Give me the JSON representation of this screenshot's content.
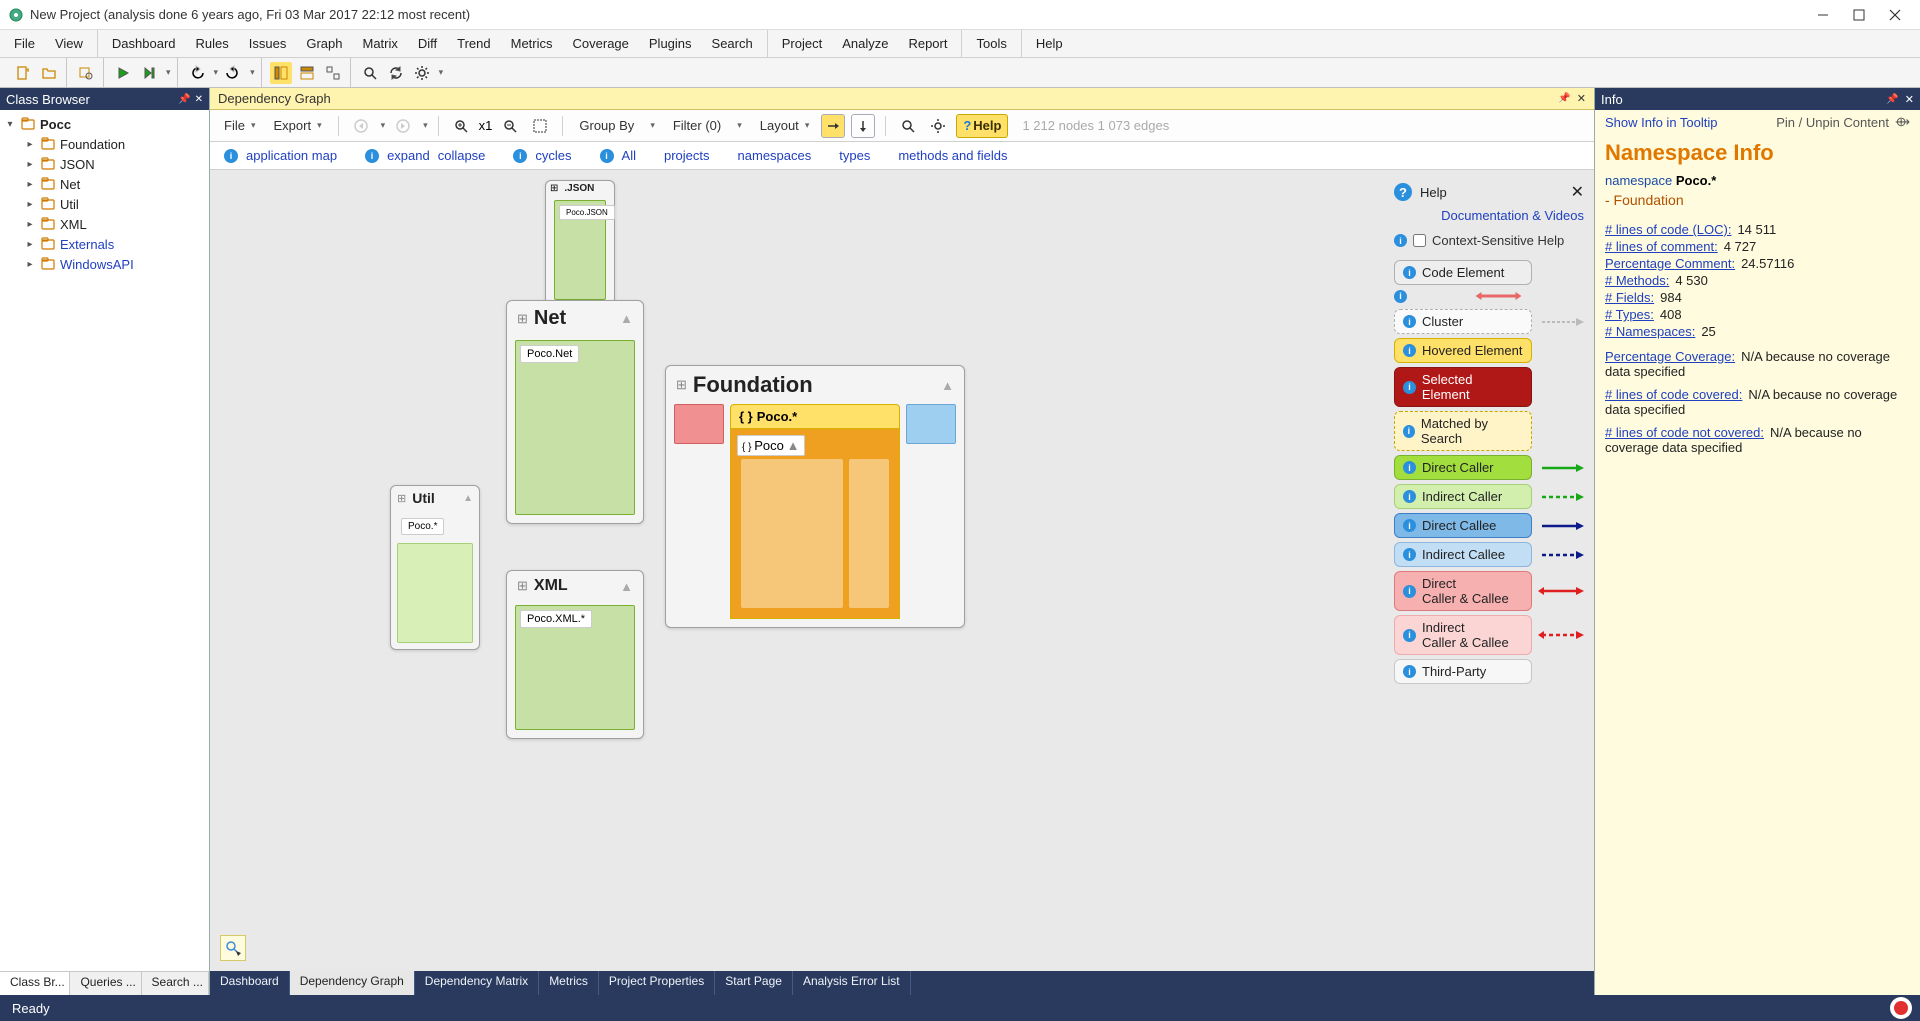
{
  "titlebar": {
    "text": "New Project  (analysis done 6 years ago, Fri 03 Mar 2017  22:12 most recent)"
  },
  "menubar": {
    "group1": [
      "File",
      "View"
    ],
    "group2": [
      "Dashboard",
      "Rules",
      "Issues",
      "Graph",
      "Matrix",
      "Diff",
      "Trend",
      "Metrics",
      "Coverage",
      "Plugins",
      "Search"
    ],
    "group3": [
      "Project",
      "Analyze",
      "Report"
    ],
    "group4": [
      "Tools"
    ],
    "group5": [
      "Help"
    ]
  },
  "class_browser": {
    "title": "Class Browser",
    "root": "Pocc",
    "items": [
      {
        "label": "Foundation",
        "link": false
      },
      {
        "label": "JSON",
        "link": false
      },
      {
        "label": "Net",
        "link": false
      },
      {
        "label": "Util",
        "link": false
      },
      {
        "label": "XML",
        "link": false
      },
      {
        "label": "Externals",
        "link": true
      },
      {
        "label": "WindowsAPI",
        "link": true
      }
    ],
    "tabs": [
      "Class Br...",
      "Queries ...",
      "Search ..."
    ]
  },
  "dep_panel": {
    "title": "Dependency Graph",
    "toolbar": {
      "file": "File",
      "export": "Export",
      "zoom": "x1",
      "groupby": "Group By",
      "filter": "Filter (0)",
      "layout": "Layout",
      "help": "Help",
      "stats": "1 212 nodes 1 073 edges"
    },
    "linkbar": {
      "appmap": "application map",
      "expand": "expand",
      "collapse": "collapse",
      "cycles": "cycles",
      "all": "All",
      "projects": "projects",
      "namespaces": "namespaces",
      "types": "types",
      "methods": "methods and fields"
    },
    "nodes": {
      "json": {
        "title": ".JSON",
        "sub": "Poco.JSON"
      },
      "net": {
        "title": "Net",
        "sub": "Poco.Net"
      },
      "util": {
        "title": "Util",
        "sub": "Poco.*"
      },
      "xml": {
        "title": "XML",
        "sub": "Poco.XML.*"
      },
      "foundation": {
        "title": "Foundation",
        "sub": "Poco.*",
        "inner": "Poco"
      }
    },
    "help_overlay": {
      "title": "Help",
      "doc_link": "Documentation & Videos",
      "cshelp": "Context-Sensitive Help",
      "legend": [
        {
          "label": "Code Element",
          "bg": "#eeeeee",
          "border": "#b0b0b0"
        },
        {
          "label": "Cluster",
          "bg": "#fafafa",
          "border": "#b0b0b0",
          "dashed": true
        },
        {
          "label": "Hovered Element",
          "bg": "#ffe069",
          "border": "#d5b200"
        },
        {
          "label": "Selected Element",
          "bg": "#b01818",
          "border": "#8a1212",
          "textcolor": "#fff"
        },
        {
          "label": "Matched by Search",
          "bg": "#fff4c8",
          "border": "#c7a800",
          "dashed": true
        },
        {
          "label": "Direct Caller",
          "bg": "#a3de3f",
          "border": "#7ab030",
          "arrow": "#16a816"
        },
        {
          "label": "Indirect Caller",
          "bg": "#d3efae",
          "border": "#a7cf77",
          "arrow": "#16a816",
          "arrow_dash": true
        },
        {
          "label": "Direct Callee",
          "bg": "#7fb9e8",
          "border": "#3c7fc7",
          "arrow": "#0d1a8a"
        },
        {
          "label": "Indirect Callee",
          "bg": "#c1def5",
          "border": "#8cb6dd",
          "arrow": "#0d1a8a",
          "arrow_dash": true
        },
        {
          "label": "Direct\nCaller & Callee",
          "bg": "#f7b0b0",
          "border": "#e07a7a",
          "arrow": "#e02020",
          "double": true
        },
        {
          "label": "Indirect\nCaller & Callee",
          "bg": "#fbd4d4",
          "border": "#edabab",
          "arrow": "#e02020",
          "arrow_dash": true,
          "double": true
        },
        {
          "label": "Third-Party",
          "bg": "#f7f7f7",
          "border": "#c7c7c7"
        }
      ]
    },
    "tabs": [
      "Dashboard",
      "Dependency Graph",
      "Dependency Matrix",
      "Metrics",
      "Project Properties",
      "Start Page",
      "Analysis Error List"
    ]
  },
  "info_panel": {
    "title": "Info",
    "tooltip_link": "Show Info in Tooltip",
    "pin": "Pin / Unpin Content",
    "heading": "Namespace Info",
    "namespace_prefix": "namespace ",
    "namespace": "Poco.*",
    "subitem": "- Foundation",
    "metrics": [
      {
        "label": "# lines of code (LOC):",
        "value": "14 511"
      },
      {
        "label": "# lines of comment:",
        "value": "4 727"
      },
      {
        "label": "Percentage Comment:",
        "value": "24.57116"
      },
      {
        "label": "# Methods:",
        "value": "4 530"
      },
      {
        "label": "# Fields:",
        "value": "984"
      },
      {
        "label": "# Types:",
        "value": "408"
      },
      {
        "label": "# Namespaces:",
        "value": "25"
      }
    ],
    "coverage": [
      {
        "label": "Percentage Coverage:",
        "value": "N/A because no coverage data specified"
      },
      {
        "label": "# lines of code covered:",
        "value": "N/A because no coverage data specified"
      },
      {
        "label": "# lines of code not covered:",
        "value": "N/A because no coverage data specified"
      }
    ]
  },
  "statusbar": {
    "text": "Ready"
  }
}
